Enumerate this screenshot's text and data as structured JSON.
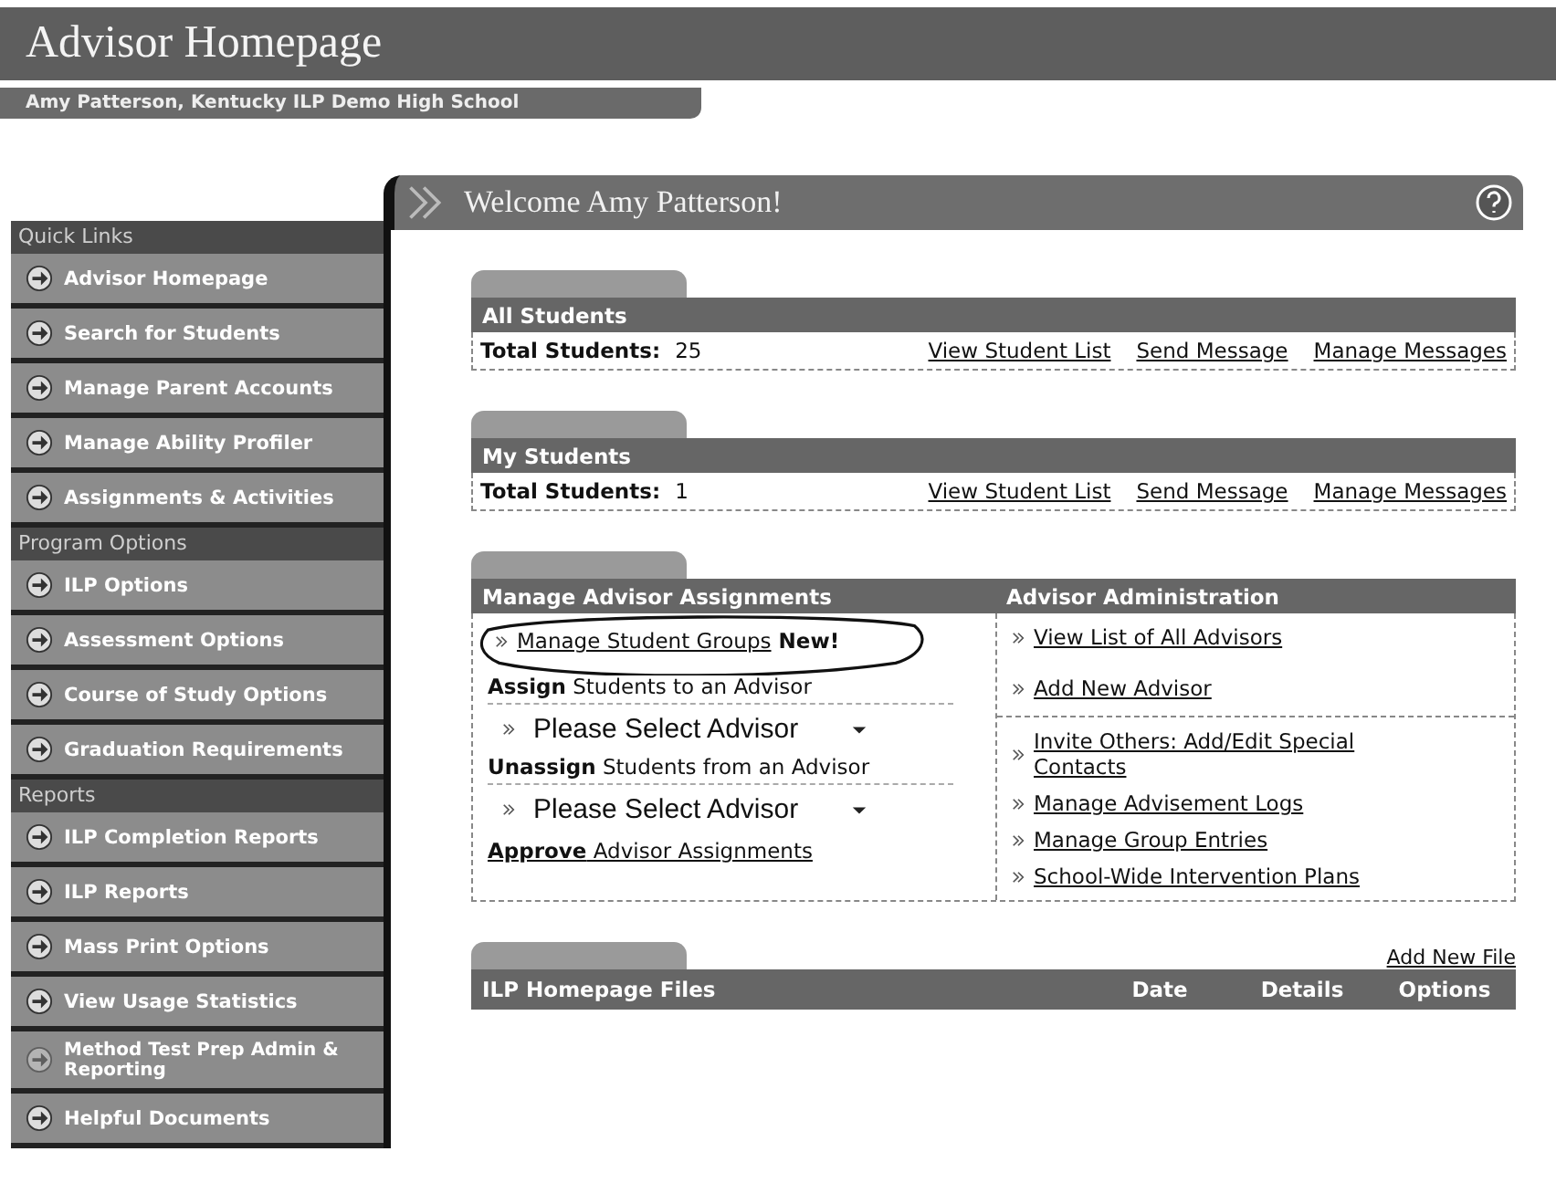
{
  "header": {
    "title": "Advisor Homepage",
    "subtitle": "Amy Patterson, Kentucky ILP Demo High School"
  },
  "sidebar": [
    {
      "kind": "header",
      "label": "Quick Links"
    },
    {
      "kind": "item",
      "label": "Advisor Homepage"
    },
    {
      "kind": "item",
      "label": "Search for Students"
    },
    {
      "kind": "item",
      "label": "Manage Parent Accounts"
    },
    {
      "kind": "item",
      "label": "Manage Ability Profiler"
    },
    {
      "kind": "item",
      "label": "Assignments & Activities"
    },
    {
      "kind": "header",
      "label": "Program Options"
    },
    {
      "kind": "item",
      "label": "ILP Options"
    },
    {
      "kind": "item",
      "label": "Assessment Options"
    },
    {
      "kind": "item",
      "label": "Course of Study Options"
    },
    {
      "kind": "item",
      "label": "Graduation Requirements"
    },
    {
      "kind": "header",
      "label": "Reports"
    },
    {
      "kind": "item",
      "label": "ILP Completion Reports"
    },
    {
      "kind": "item",
      "label": "ILP Reports"
    },
    {
      "kind": "item",
      "label": "Mass Print Options"
    },
    {
      "kind": "item",
      "label": "View Usage Statistics"
    },
    {
      "kind": "item2",
      "label": "Method Test Prep Admin & Reporting"
    },
    {
      "kind": "item",
      "label": "Helpful Documents"
    }
  ],
  "welcome": {
    "title": "Welcome Amy Patterson!"
  },
  "student_sections": [
    {
      "title": "All Students",
      "total_label": "Total Students:",
      "total": "25",
      "links": [
        "View Student List",
        "Send Message",
        "Manage Messages"
      ]
    },
    {
      "title": "My Students",
      "total_label": "Total Students:",
      "total": "1",
      "links": [
        "View Student List",
        "Send Message",
        "Manage Messages"
      ]
    }
  ],
  "assignments": {
    "left_title": "Manage Advisor Assignments",
    "right_title": "Advisor Administration",
    "groups_link": {
      "label": "Manage Student Groups",
      "badge": "New!",
      "circled": true
    },
    "left_rows": [
      {
        "kind": "label",
        "text": "**Assign** Students to an Advisor"
      },
      {
        "kind": "select",
        "placeholder": "Please Select Advisor"
      },
      {
        "kind": "label",
        "text": "**Unassign** Students from an Advisor"
      },
      {
        "kind": "select",
        "placeholder": "Please Select Advisor"
      },
      {
        "kind": "link",
        "text": "**Approve** Advisor Assignments"
      }
    ],
    "right_groups": [
      [
        "View List of All Advisors",
        "Add New Advisor"
      ],
      [
        "Invite Others: Add/Edit Special Contacts",
        "Manage Advisement Logs",
        "Manage Group Entries",
        "School-Wide Intervention Plans"
      ]
    ]
  },
  "files": {
    "title": "ILP Homepage Files",
    "add_link": "Add New File",
    "columns": [
      "Date",
      "Details",
      "Options"
    ]
  }
}
